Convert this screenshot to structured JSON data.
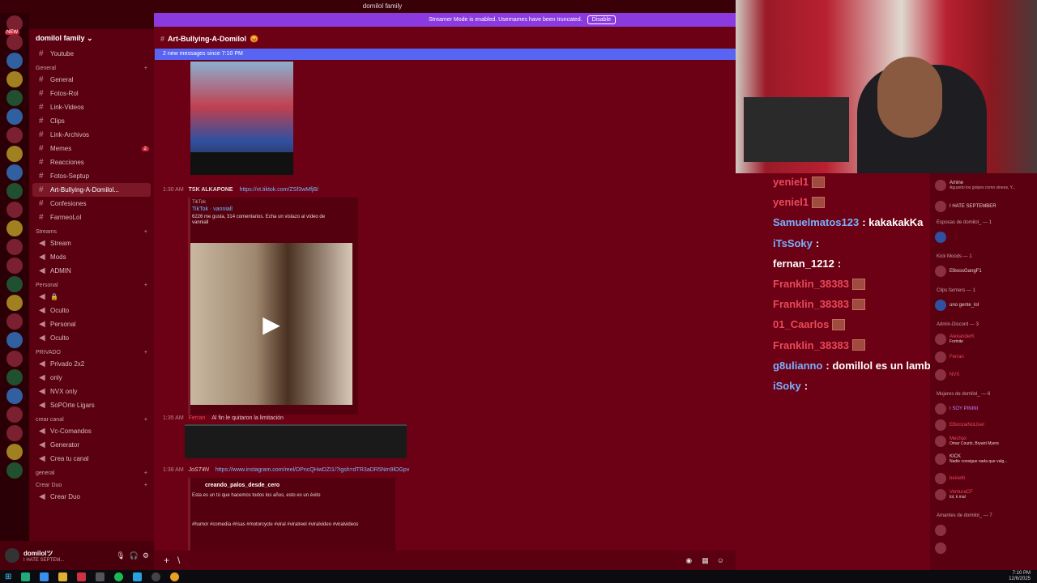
{
  "top_title": "domilol family",
  "banner": {
    "text": "Streamer Mode is enabled. Usernames have been truncated.",
    "button": "Disable"
  },
  "server_name": "domilol family",
  "channel_title": "Art-Bullying-A-Domilol",
  "new_messages": "2 new messages since 7:10 PM",
  "sidebar": {
    "youtube": "Youtube",
    "cat_general": "General",
    "general_channels": [
      "General",
      "Fotos-Rol",
      "Link-Videos",
      "Clips",
      "Link-Archivos",
      "Memes",
      "Reacciones",
      "Fotos-Septup",
      "Art-Bullying-A-Domilol...",
      "Confesiones",
      "FarmeoLol"
    ],
    "memes_badge": "2",
    "cat_streams": "Streams",
    "stream_channels": [
      "Stream",
      "Mods",
      "ADMIN"
    ],
    "cat_personal": "Personal",
    "personal_channels": [
      "Oculto",
      "Personal",
      "Oculto"
    ],
    "cat_privado": "PRIVADO",
    "privado_channels": [
      "Privado 2x2",
      "only",
      "NVX only",
      "SoPOrte Ligars"
    ],
    "cat_crear": "crear canal",
    "crear_channels": [
      "Vc-Comandos",
      "Generator",
      "Crea tu canal"
    ],
    "cat_general2": "general",
    "cat_duo": "Crear Duo",
    "duo_channels": [
      "Crear Duo"
    ]
  },
  "user": {
    "name": "domilolツ",
    "status": "I HATE SEPTEM..."
  },
  "messages": {
    "m1_time": "1:30 AM",
    "m1_user": "TSK ALKAPONE",
    "m1_link": "https://vt.tiktok.com/ZSf3wMfjB/",
    "tiktok_site": "TikTok",
    "tiktok_title": "TikTok · vanniall",
    "tiktok_desc1": "6226 me gusta, 314 comentarios. Echa un vistazo al vídeo de",
    "tiktok_desc2": "vanniall",
    "m2_time": "1:35 AM",
    "m2_user": "Ferran",
    "m2_text": "Al fin le quitaron la limitación",
    "m3_time": "1:38 AM",
    "m3_user": "JoST4N",
    "m3_link": "https://www.instagram.com/reel/DPncQHwDZI1/?igsh=dTR3aDR5Nm9lOGpv",
    "ig_user": "creando_palos_desde_cero",
    "ig_text": "Esta es un tú que hacemos todos los años, esto es un éxito",
    "ig_tags": "#humor #comedia #risas #motorcycle #viral #viralreel #viralvideo #viralvideos"
  },
  "chat": [
    {
      "user": "yeniel1",
      "text": "",
      "color": "#e84a5a"
    },
    {
      "user": "yeniel1",
      "text": "",
      "color": "#e84a5a"
    },
    {
      "user": "Samuelmatos123",
      "text": ": kakakakKa",
      "color": "#7ab0ff"
    },
    {
      "user": "iTsSoky",
      "text": ":",
      "color": "#7ab0ff"
    },
    {
      "user": "fernan_1212",
      "text": ":",
      "color": "#ffffff"
    },
    {
      "user": "Franklin_38383",
      "text": "",
      "color": "#e84a5a"
    },
    {
      "user": "Franklin_38383",
      "text": "",
      "color": "#e84a5a"
    },
    {
      "user": "01_Caarlos",
      "text": "",
      "color": "#e84a5a"
    },
    {
      "user": "Franklin_38383",
      "text": "",
      "color": "#e84a5a"
    },
    {
      "user": "g8ulianno",
      "text": ": domillol es un lambon",
      "color": "#7ab0ff"
    },
    {
      "user": "iSoky",
      "text": ":",
      "color": "#7ab0ff"
    }
  ],
  "members": {
    "top1": "Amine",
    "top2": "Aguanto los golpes como vinees, Y...",
    "top3": "I HATE SEPTEMBER",
    "h_esposas": "Esposas de domilol_ — 1",
    "h_kick": "Kick Moods — 1",
    "kick1": "ElbossGangF1",
    "h_clips": "Clips farmers — 1",
    "clips1": "uno gente_lol",
    "h_admin": "Admin-Discord — 3",
    "admin1": "AlexanderK",
    "admin1s": "Fortnite",
    "admin2": "Ferran",
    "admin3": "NVX",
    "h_mujeres": "Mujeres de domilol_ — 6",
    "muj1": "I SOY PININI",
    "muj2": "EBonzaiNotJoel",
    "muj3": "Mechax",
    "muj3s": "Omar Courtz, Bryant Myers",
    "muj4": "KICK",
    "muj4s": "Nadie consigue nada que valg...",
    "muj5": "beisetti",
    "muj6": "VenturaCF",
    "muj6s": "lol, k mal",
    "h_amantes": "Amantes de domilol_ — 7"
  },
  "clock": {
    "time": "7:10 PM",
    "date": "12/6/2025"
  }
}
